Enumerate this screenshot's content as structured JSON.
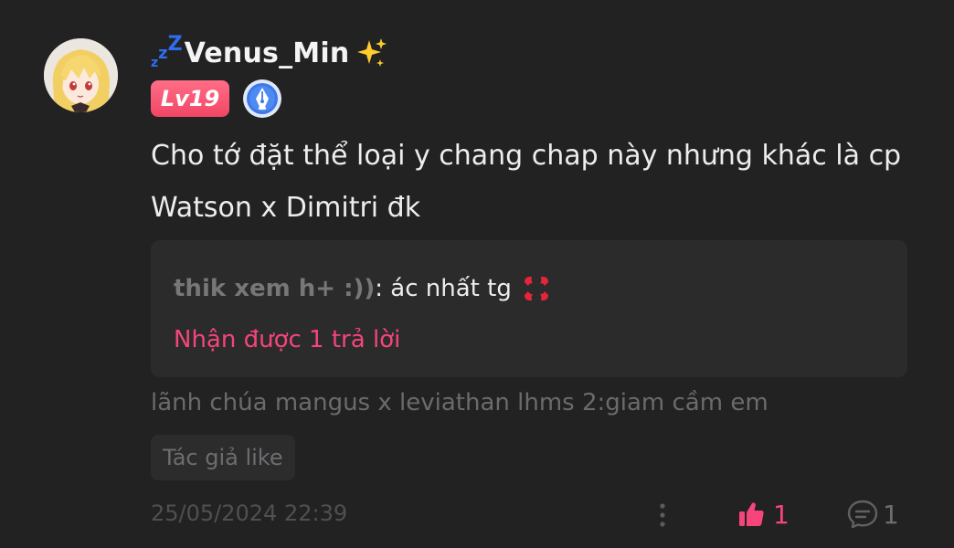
{
  "user": {
    "name": "Venus_Min",
    "prefix_decoration": "ᶻᶻᶻ",
    "suffix_emoji": "sparkles-icon",
    "level_badge": "Lv19",
    "author_badge_icon": "pen-nib-badge-icon"
  },
  "comment": {
    "text": "Cho tớ đặt thể loại y chang chap này nhưng khác là cp Watson x Dimitri đk"
  },
  "reply_preview": {
    "author": "thik xem h+ :))",
    "separator": ": ",
    "text": "ác nhất tg",
    "emoji": "anger-symbol-icon",
    "reply_count_label": "Nhận được 1 trả lời"
  },
  "story_title": "lãnh chúa mangus x leviathan lhms 2:giam cầm em",
  "author_like_label": "Tác giả like",
  "timestamp": "25/05/2024 22:39",
  "actions": {
    "like_count": "1",
    "reply_count": "1"
  },
  "colors": {
    "background": "#222223",
    "accent_pink": "#f5457a",
    "level_badge": "#f24566",
    "zzz_blue": "#2f6df0",
    "muted_text": "#6b6b6e"
  }
}
